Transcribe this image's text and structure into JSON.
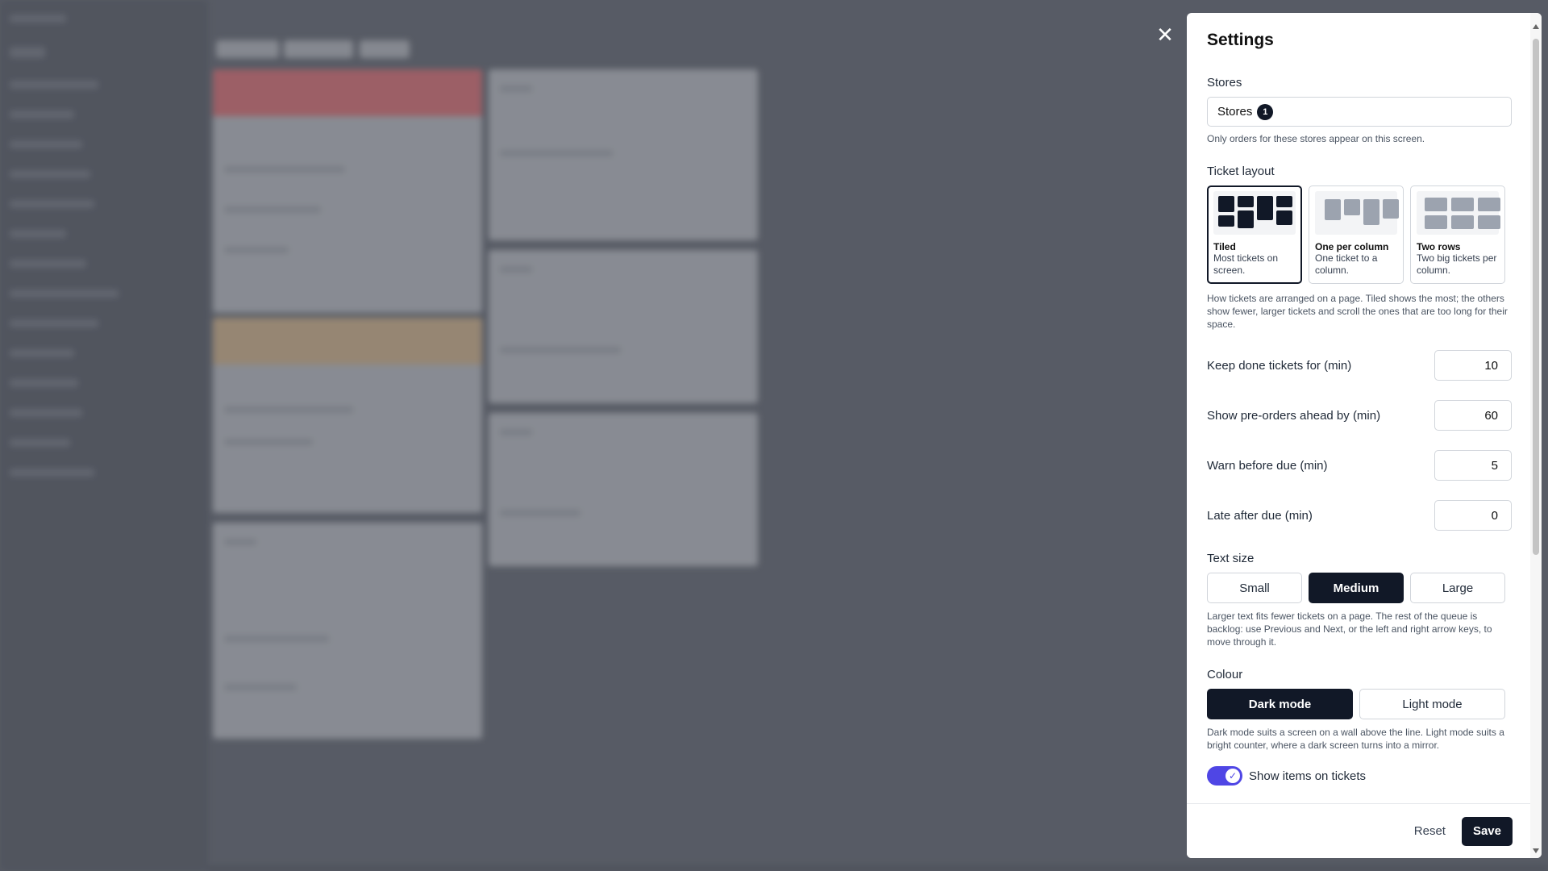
{
  "settings": {
    "title": "Settings",
    "stores": {
      "label": "Stores",
      "field_text": "Stores",
      "selected_count": "1",
      "help": "Only orders for these stores appear on this screen."
    },
    "ticket_layout": {
      "label": "Ticket layout",
      "options": [
        {
          "name": "Tiled",
          "desc": "Most tickets on screen.",
          "selected": true
        },
        {
          "name": "One per column",
          "desc": "One ticket to a column.",
          "selected": false
        },
        {
          "name": "Two rows",
          "desc": "Two big tickets per column.",
          "selected": false
        }
      ],
      "help": "How tickets are arranged on a page. Tiled shows the most; the others show fewer, larger tickets and scroll the ones that are too long for their space."
    },
    "numbers": [
      {
        "label": "Keep done tickets for (min)",
        "value": "10"
      },
      {
        "label": "Show pre-orders ahead by (min)",
        "value": "60"
      },
      {
        "label": "Warn before due (min)",
        "value": "5"
      },
      {
        "label": "Late after due (min)",
        "value": "0"
      }
    ],
    "text_size": {
      "label": "Text size",
      "options": [
        "Small",
        "Medium",
        "Large"
      ],
      "selected": "Medium",
      "help": "Larger text fits fewer tickets on a page. The rest of the queue is backlog: use Previous and Next, or the left and right arrow keys, to move through it."
    },
    "colour": {
      "label": "Colour",
      "options": [
        "Dark mode",
        "Light mode"
      ],
      "selected": "Dark mode",
      "help": "Dark mode suits a screen on a wall above the line. Light mode suits a bright counter, where a dark screen turns into a mirror."
    },
    "show_items": {
      "label": "Show items on tickets",
      "on": true
    },
    "footer": {
      "reset_label": "Reset",
      "save_label": "Save"
    }
  },
  "icons": {
    "close": "close-icon",
    "check": "check-icon"
  },
  "colors": {
    "primary": "#111827",
    "toggle_on": "#4f46e5",
    "backdrop": "#5d616b"
  }
}
